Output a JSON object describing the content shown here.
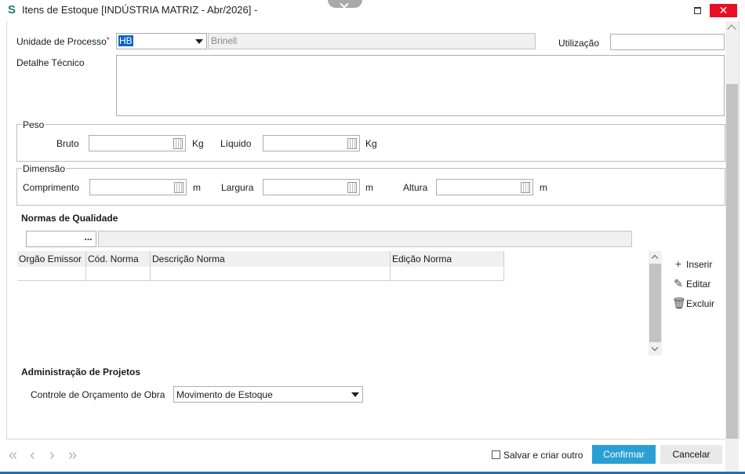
{
  "window": {
    "title": "Itens de Estoque [INDÚSTRIA MATRIZ - Abr/2026]  -",
    "close_glyph": "✕"
  },
  "form": {
    "unidade_label": "Unidade de Processo",
    "unidade_value": "HB",
    "unidade_desc": "Brinell",
    "utilizacao_label": "Utilização",
    "detalhe_label": "Detalhe Técnico"
  },
  "peso": {
    "title": "Peso",
    "bruto_label": "Bruto",
    "liquido_label": "Líquido",
    "unit": "Kg"
  },
  "dimensao": {
    "title": "Dimensão",
    "comprimento_label": "Comprimento",
    "largura_label": "Largura",
    "altura_label": "Altura",
    "unit": "m"
  },
  "normas": {
    "title": "Normas de Qualidade",
    "dots": "...",
    "columns": [
      "Orgão Emissor",
      "Cód. Norma",
      "Descrição Norma",
      "Edição Norma"
    ],
    "actions": {
      "inserir": "Inserir",
      "editar": "Editar",
      "excluir": "Excluir"
    }
  },
  "projetos": {
    "title": "Administração de Projetos",
    "controle_label": "Controle de Orçamento de Obra",
    "controle_value": "Movimento de Estoque"
  },
  "footer": {
    "salvar_label": "Salvar e criar outro",
    "confirmar_label": "Confirmar",
    "cancelar_label": "Cancelar"
  },
  "icons": {
    "first": "first-record-icon",
    "prev": "previous-record-icon",
    "next": "next-record-icon",
    "last": "last-record-icon"
  },
  "colors": {
    "accent": "#2a9fd6",
    "close": "#e81123",
    "required": "#d0021b"
  }
}
